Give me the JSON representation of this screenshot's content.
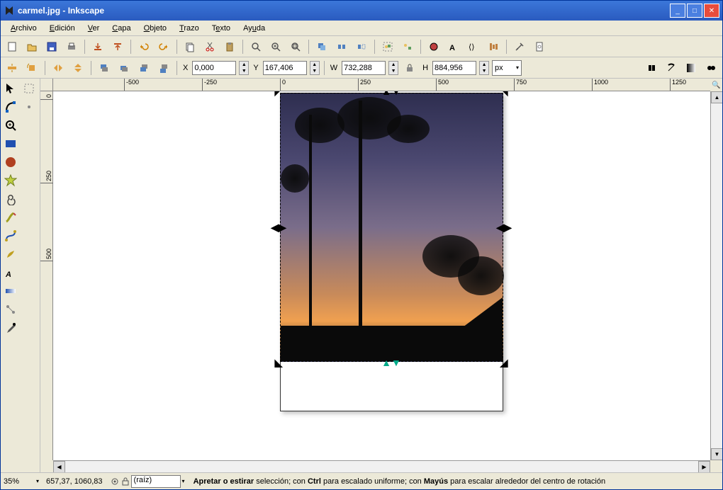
{
  "titlebar": {
    "title": "carmel.jpg - Inkscape"
  },
  "menu": {
    "archivo": "Archivo",
    "edicion": "Edición",
    "ver": "Ver",
    "capa": "Capa",
    "objeto": "Objeto",
    "trazo": "Trazo",
    "texto": "Texto",
    "ayuda": "Ayuda"
  },
  "coords": {
    "x_label": "X",
    "x": "0,000",
    "y_label": "Y",
    "y": "167,406",
    "w_label": "W",
    "w": "732,288",
    "h_label": "H",
    "h": "884,956",
    "unit": "px"
  },
  "ruler_h": [
    "-500",
    "-250",
    "0",
    "250",
    "500",
    "750",
    "1000",
    "1250"
  ],
  "ruler_v": [
    "0",
    "250",
    "500"
  ],
  "status": {
    "zoom": "35%",
    "cursor": "657,37, 1060,83",
    "layer": "(raíz)",
    "hint_bold1": "Apretar o estirar",
    "hint_mid1": " selección; con ",
    "hint_bold2": "Ctrl",
    "hint_mid2": " para escalado uniforme; con ",
    "hint_bold3": "Mayús",
    "hint_mid3": " para escalar alrededor del centro de rotación"
  }
}
